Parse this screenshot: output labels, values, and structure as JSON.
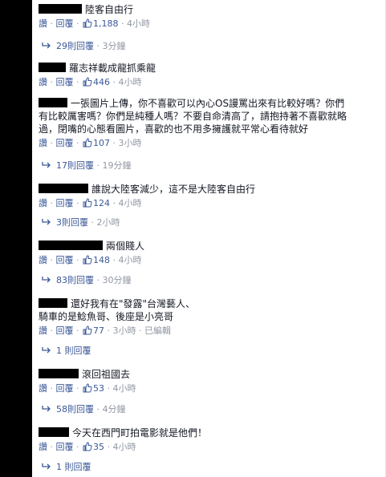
{
  "actions": {
    "like": "讚",
    "reply": "回覆",
    "sep": " · "
  },
  "comments": [
    {
      "text": "陸客自由行",
      "likes": "1,188",
      "time": "4小時",
      "replies": {
        "count": "29則回覆",
        "time": "3分鐘"
      }
    },
    {
      "text": "羅志祥載成龍抓乘龍",
      "likes": "446",
      "time": "4小時"
    },
    {
      "text_lines": [
        "一張圖片上傳，你不喜歡可以內心OS謾罵出來有比較好嗎？你們",
        "有比較厲害嗎？你們是純種人嗎？不要自命清高了，請抱持著不喜歡就略",
        "過，閉嘴的心態看圖片，喜歡的也不用多擁護就平常心看待就好"
      ],
      "likes": "107",
      "time": "3小時",
      "replies": {
        "count": "17則回覆",
        "time": "19分鐘"
      }
    },
    {
      "text": "誰說大陸客減少，這不是大陸客自由行",
      "likes": "124",
      "time": "4小時",
      "replies": {
        "count": "3則回覆",
        "time": "2小時"
      }
    },
    {
      "text": "兩個賤人",
      "likes": "148",
      "time": "4小時",
      "replies": {
        "count": "83則回覆",
        "time": "30分鐘"
      }
    },
    {
      "text_lines": [
        "還好我有在\"發露\"台灣藝人、",
        "騎車的是鯰魚哥、後座是小亮哥"
      ],
      "likes": "77",
      "time": "3小時",
      "edited": "已編輯",
      "replies": {
        "count": "1 則回覆",
        "time": ""
      }
    },
    {
      "text": "滾回祖國去",
      "likes": "53",
      "time": "4小時",
      "replies": {
        "count": "58則回覆",
        "time": "4分鐘"
      }
    },
    {
      "text": "今天在西門町拍電影就是他們！",
      "likes": "35",
      "time": "4小時",
      "replies": {
        "count": "1 則回覆",
        "time": ""
      }
    }
  ],
  "colors": {
    "link": "#3b5998",
    "meta": "#9197a3",
    "text": "#141823"
  },
  "icons": {
    "like": "thumbs-up-icon",
    "reply": "reply-arrow-icon"
  }
}
